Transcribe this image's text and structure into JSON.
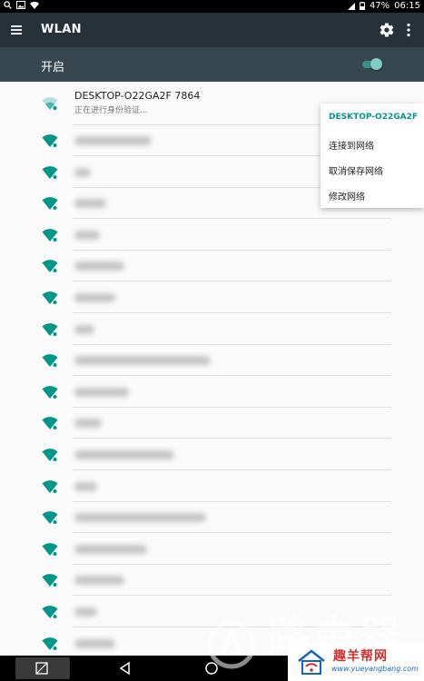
{
  "status_bar": {
    "battery": "47%",
    "time": "06:15"
  },
  "app_bar": {
    "title": "WLAN"
  },
  "switch_bar": {
    "label": "开启",
    "enabled": true
  },
  "current_network": {
    "ssid": "DESKTOP-O22GA2F 7864",
    "status": "正在进行身份验证..."
  },
  "popup_menu": {
    "header": "DESKTOP-O22GA2F 7...",
    "items": [
      "连接到网络",
      "取消保存网络",
      "修改网络"
    ]
  },
  "watermark": {
    "text": "路由器",
    "brand": "趣羊帮网",
    "url": "www.yueyangbang.com"
  },
  "colors": {
    "accent": "#009688",
    "app_bar": "#263238",
    "switch_bar": "#37474f"
  }
}
